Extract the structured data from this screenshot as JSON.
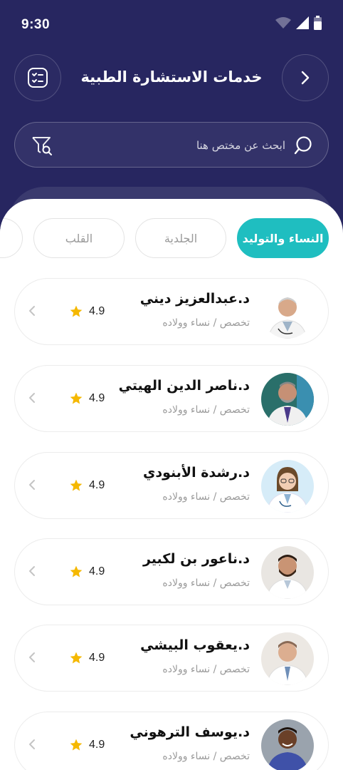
{
  "status": {
    "time": "9:30"
  },
  "header": {
    "title": "خدمات الاستشارة الطبية"
  },
  "search": {
    "placeholder": "ابحث عن مختص هنا"
  },
  "tabs": [
    {
      "label": "النساء والتوليد",
      "active": true
    },
    {
      "label": "الجلدية",
      "active": false
    },
    {
      "label": "القلب",
      "active": false
    }
  ],
  "doctors": [
    {
      "name": "د.عبدالعزيز ديني",
      "spec": "تخصص / نساء وولاده",
      "rating": "4.9"
    },
    {
      "name": "د.ناصر الدين الهيتي",
      "spec": "تخصص / نساء وولاده",
      "rating": "4.9"
    },
    {
      "name": "د.رشدة الأبنودي",
      "spec": "تخصص / نساء وولاده",
      "rating": "4.9"
    },
    {
      "name": "د.ناعور بن لكبير",
      "spec": "تخصص / نساء وولاده",
      "rating": "4.9"
    },
    {
      "name": "د.يعقوب البيشي",
      "spec": "تخصص / نساء وولاده",
      "rating": "4.9"
    },
    {
      "name": "د.يوسف الترهوني",
      "spec": "تخصص / نساء وولاده",
      "rating": "4.9"
    }
  ],
  "colors": {
    "primary_bg": "#272660",
    "accent": "#1fbec0",
    "star": "#f5b800"
  }
}
